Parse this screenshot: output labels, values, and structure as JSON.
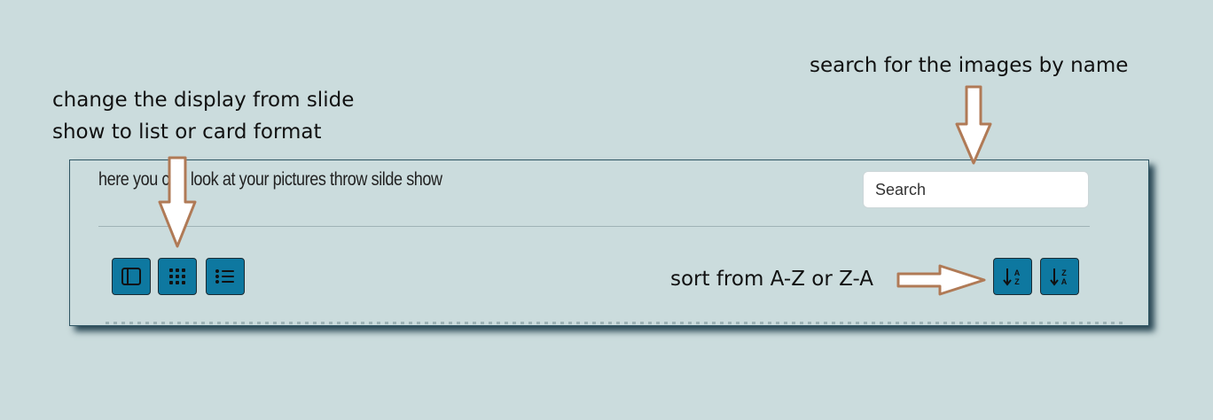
{
  "annotations": {
    "display_line1": "change the display from slide",
    "display_line2": "show to list or card format",
    "search": "search for the images by name",
    "sort": "sort from A-Z or Z-A"
  },
  "panel": {
    "title": "here you can look at your pictures throw silde show",
    "search_placeholder": "Search"
  },
  "toolbar": {
    "view_buttons": [
      "slide-view-icon",
      "card-grid-icon",
      "list-view-icon"
    ],
    "sort_buttons": [
      "sort-a-z-icon",
      "sort-z-a-icon"
    ],
    "button_color": "#0e78a0"
  },
  "colors": {
    "background": "#cbdcdd",
    "arrow_fill": "#ffffff",
    "arrow_outline": "#b07a56"
  }
}
